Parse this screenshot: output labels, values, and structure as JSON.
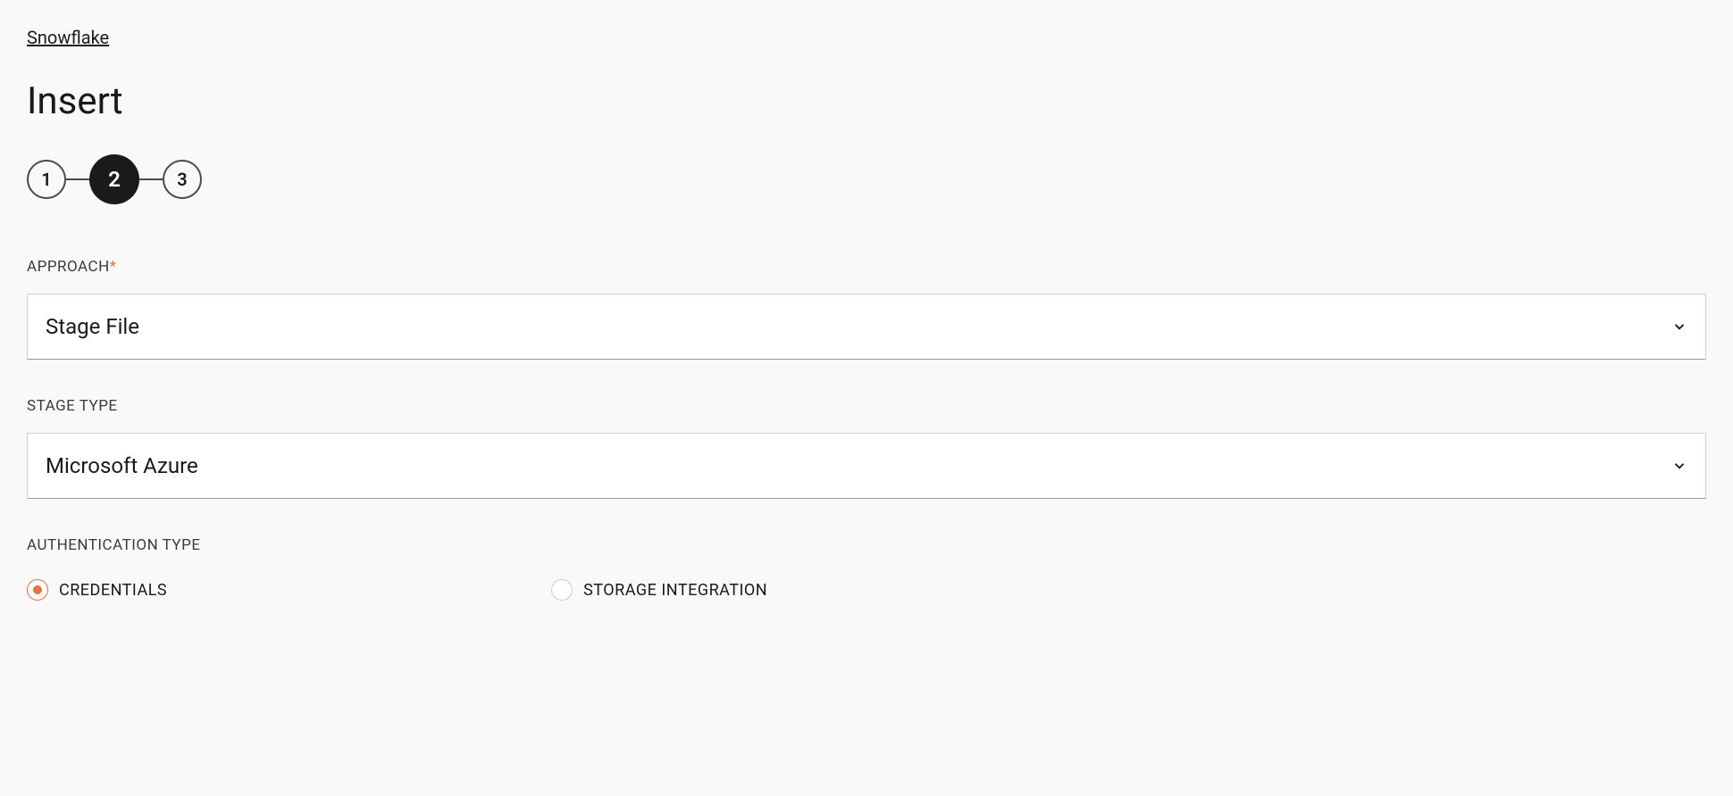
{
  "breadcrumb": {
    "label": "Snowflake"
  },
  "page": {
    "title": "Insert"
  },
  "stepper": {
    "steps": [
      "1",
      "2",
      "3"
    ],
    "active_index": 1
  },
  "form": {
    "approach": {
      "label": "APPROACH",
      "required": true,
      "value": "Stage File"
    },
    "stage_type": {
      "label": "STAGE TYPE",
      "required": false,
      "value": "Microsoft Azure"
    },
    "auth_type": {
      "label": "AUTHENTICATION TYPE",
      "options": [
        {
          "label": "CREDENTIALS",
          "checked": true
        },
        {
          "label": "STORAGE INTEGRATION",
          "checked": false
        }
      ]
    }
  },
  "required_mark": "*"
}
